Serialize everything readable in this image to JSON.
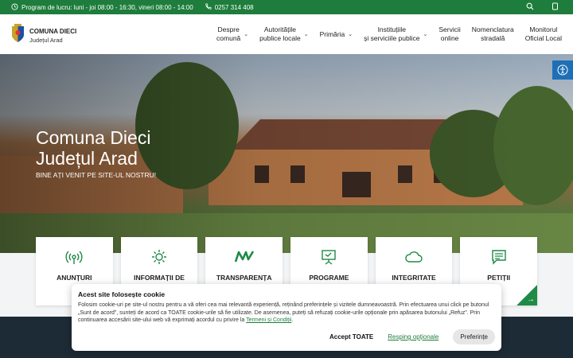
{
  "topbar": {
    "schedule": "Program de lucru: luni - joi 08:00 - 16:30, vineri 08:00 - 14:00",
    "phone": "0257 314 408"
  },
  "header": {
    "brand_title": "COMUNA DIECI",
    "brand_subtitle": "Județul Arad",
    "nav": [
      {
        "line1": "Despre",
        "line2": "comună"
      },
      {
        "line1": "Autoritățile",
        "line2": "publice locale"
      },
      {
        "line1": "Primăria",
        "line2": ""
      },
      {
        "line1": "Instituțiile",
        "line2": "și serviciile publice"
      },
      {
        "line1": "Servicii",
        "line2": "online"
      },
      {
        "line1": "Nomenclatura",
        "line2": "stradală"
      },
      {
        "line1": "Monitorul",
        "line2": "Oficial Local"
      }
    ]
  },
  "hero": {
    "title_line1": "Comuna Dieci",
    "title_line2": "Județul Arad",
    "subtitle": "BINE AȚI VENIT PE SITE-UL NOSTRU!"
  },
  "cards": [
    {
      "label": "ANUNȚURI",
      "icon": "broadcast-icon"
    },
    {
      "label": "INFORMAȚII DE",
      "icon": "sun-icon"
    },
    {
      "label": "TRANSPARENȚA",
      "icon": "mv-icon"
    },
    {
      "label": "PROGRAME",
      "icon": "easel-icon"
    },
    {
      "label": "INTEGRITATE",
      "icon": "cloud-icon"
    },
    {
      "label": "PETIȚII",
      "icon": "message-icon"
    }
  ],
  "cookie": {
    "title": "Acest site folosește cookie",
    "text": "Folosim cookie-uri pe site-ul nostru pentru a vă oferi cea mai relevantă experiență, reținând preferințele și vizitele dumneavoastră. Prin efectuarea unui click pe butonul „Sunt de acord”, sunteți de acord ca TOATE cookie-urile să fie utilizate. De asemenea, puteți să refuzați cookie-urile opționale prin apăsarea butonului „Refuz”. Prin continuarea accesării site-ului web vă exprimați acordul cu privire la",
    "link": "Termeni și Condiții",
    "accept": "Accept TOATE",
    "refuse": "Resping opționale",
    "prefs": "Preferințe"
  },
  "colors": {
    "brand_green": "#1e7d3c",
    "accessibility_blue": "#1e6fb8",
    "footer_dark": "#1d2b36"
  }
}
